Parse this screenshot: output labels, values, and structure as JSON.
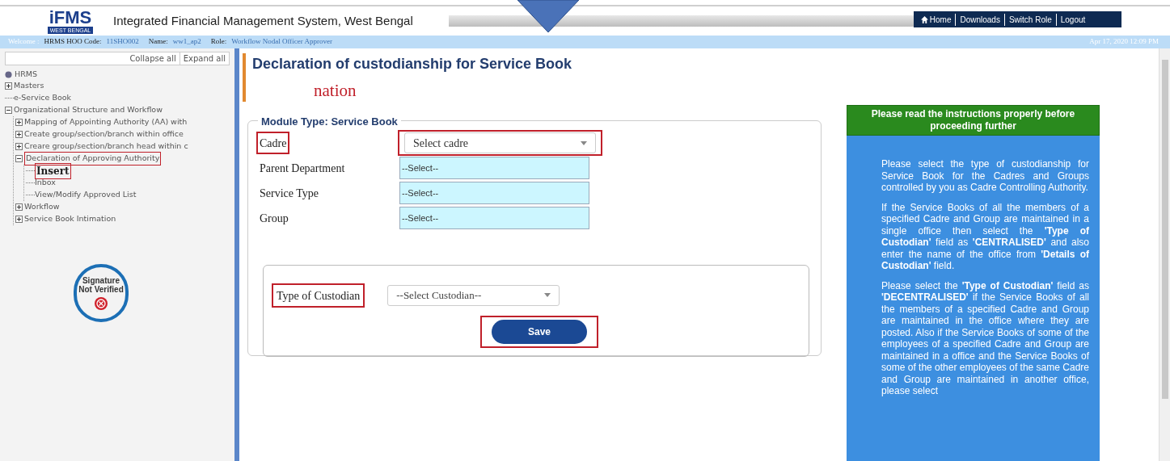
{
  "header": {
    "logo": {
      "name": "iFMS",
      "region": "WEST BENGAL"
    },
    "title": "Integrated Financial Management System, West Bengal",
    "nav": [
      "Home",
      "Downloads",
      "Switch Role",
      "Logout"
    ]
  },
  "info_bar": {
    "welcome": "Welcome :",
    "code_label": "HRMS HOO Code:",
    "code": "11SHO002",
    "name_label": "Name:",
    "name": "ww1_ap2",
    "role_label": "Role:",
    "role": "Workflow Nodal Officer Approver",
    "datetime": "Apr 17, 2020 12:09 PM"
  },
  "sidebar": {
    "collapse_all": "Collapse all",
    "expand_all": "Expand all",
    "root": "HRMS",
    "tree": [
      {
        "label": "Masters",
        "expanded": false,
        "selected": false,
        "highlighted": false
      },
      {
        "label": "e-Service Book",
        "selected": false,
        "highlighted": false
      },
      {
        "label": "Organizational Structure and Workflow",
        "expanded": true,
        "selected": false,
        "highlighted": false,
        "children": [
          {
            "label": "Mapping of Appointing Authority (AA) with",
            "expanded": false,
            "selected": false,
            "highlighted": false
          },
          {
            "label": "Create group/section/branch within office",
            "expanded": false,
            "selected": false,
            "highlighted": false
          },
          {
            "label": "Creare group/section/branch head within c",
            "expanded": false,
            "selected": false,
            "highlighted": false
          },
          {
            "label": "Declaration of Approving Authority",
            "expanded": true,
            "selected": false,
            "highlighted": true,
            "children": [
              {
                "label": "Insert",
                "selected": true,
                "highlighted": true
              },
              {
                "label": "Inbox",
                "selected": false,
                "highlighted": false
              },
              {
                "label": "View/Modify Approved List",
                "selected": false,
                "highlighted": false
              }
            ]
          },
          {
            "label": "Workflow",
            "expanded": false,
            "selected": false,
            "highlighted": false
          },
          {
            "label": "Service Book Intimation",
            "expanded": false,
            "selected": false,
            "highlighted": false
          }
        ]
      }
    ],
    "signature": {
      "line1": "Signature",
      "line2": "Not Verified"
    }
  },
  "page": {
    "title": "Declaration of custodianship for Service Book",
    "overlay_text": "nation",
    "module_legend": "Module Type: Service Book",
    "fields": [
      {
        "label": "Cadre",
        "value": "Select cadre",
        "kind": "dropdown",
        "highlighted": true
      },
      {
        "label": "Parent Department",
        "value": "--Select--",
        "kind": "readonly",
        "highlighted": false
      },
      {
        "label": "Service Type",
        "value": "--Select--",
        "kind": "readonly",
        "highlighted": false
      },
      {
        "label": "Group",
        "value": "--Select--",
        "kind": "readonly",
        "highlighted": false
      }
    ],
    "custodian": {
      "label": "Type of Custodian",
      "value": "--Select Custodian--",
      "highlighted": true
    },
    "save": {
      "label": "Save",
      "highlighted": true
    }
  },
  "instructions": {
    "heading": "Please read the instructions properly before proceeding further",
    "paragraphs": [
      "Please select the type of custodianship for Service Book for the Cadres and Groups controlled by you as Cadre Controlling Authority.",
      "If the Service Books of all the members of a specified Cadre and Group are maintained in a single office then select the **'Type of Custodian'** field as **'CENTRALISED'** and also enter the name of the office from **'Details of Custodian'** field.",
      "Please select the **'Type of Custodian'** field as **'DECENTRALISED'** if the Service Books of all the members of a specified Cadre and Group are maintained in the office where they are posted. Also if the Service Books of some of the employees of a specified Cadre and Group are maintained in a office and the Service Books of some of the other employees of the same Cadre and Group are maintained in another office, please select"
    ]
  }
}
